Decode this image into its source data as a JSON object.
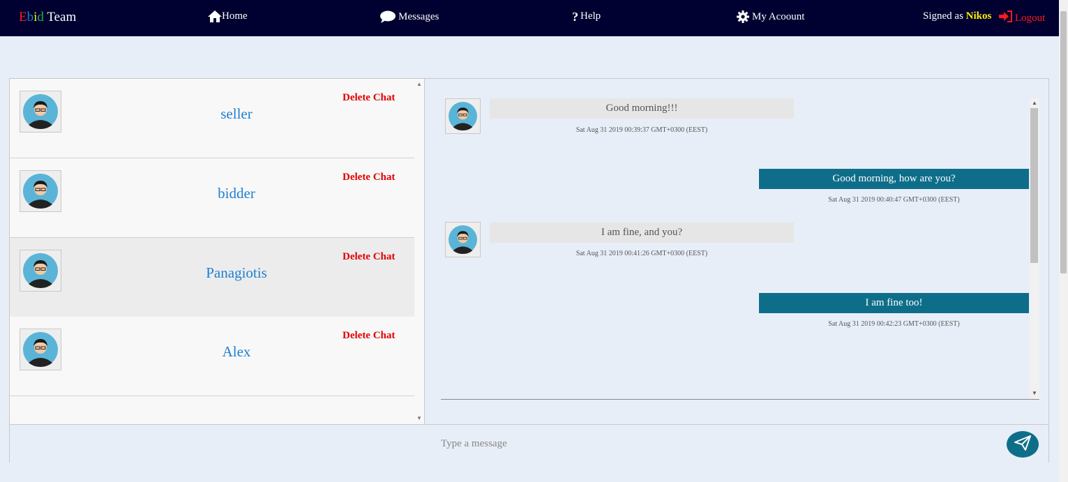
{
  "navbar": {
    "brand_letters": [
      "E",
      "b",
      "i",
      "d"
    ],
    "brand_colors": [
      "#ff1a1a",
      "#1e7fd0",
      "#ffee00",
      "#22b14c"
    ],
    "brand_team": "Team",
    "home_label": "Home",
    "messages_label": "Messages",
    "help_label": "Help",
    "account_label": "My Acoount",
    "signed_as": "Signed as",
    "username": "Nikos",
    "logout_label": "Logout"
  },
  "chats": [
    {
      "name": "seller",
      "delete_label": "Delete Chat"
    },
    {
      "name": "bidder",
      "delete_label": "Delete Chat"
    },
    {
      "name": "Panagiotis",
      "delete_label": "Delete Chat"
    },
    {
      "name": "Alex",
      "delete_label": "Delete Chat"
    }
  ],
  "messages": [
    {
      "direction": "in",
      "text": "Good morning!!!",
      "timestamp": "Sat Aug 31 2019 00:39:37 GMT+0300 (EEST)"
    },
    {
      "direction": "out",
      "text": "Good morning, how are you?",
      "timestamp": "Sat Aug 31 2019 00:40:47 GMT+0300 (EEST)"
    },
    {
      "direction": "in",
      "text": "I am fine, and you?",
      "timestamp": "Sat Aug 31 2019 00:41:26 GMT+0300 (EEST)"
    },
    {
      "direction": "out",
      "text": "I am fine too!",
      "timestamp": "Sat Aug 31 2019 00:42:23 GMT+0300 (EEST)"
    }
  ],
  "composer": {
    "placeholder": "Type a message",
    "value": ""
  },
  "icons": {
    "home": "home-icon",
    "messages": "comment-icon",
    "help": "question-icon",
    "account": "gear-icon",
    "logout": "sign-out-icon",
    "send": "paper-plane-icon",
    "avatar": "user-avatar-icon"
  },
  "colors": {
    "navbar_bg": "#010131",
    "accent": "#0e6e8a",
    "link": "#1e7fd0",
    "delete": "#e00000",
    "username": "#ffee00"
  }
}
